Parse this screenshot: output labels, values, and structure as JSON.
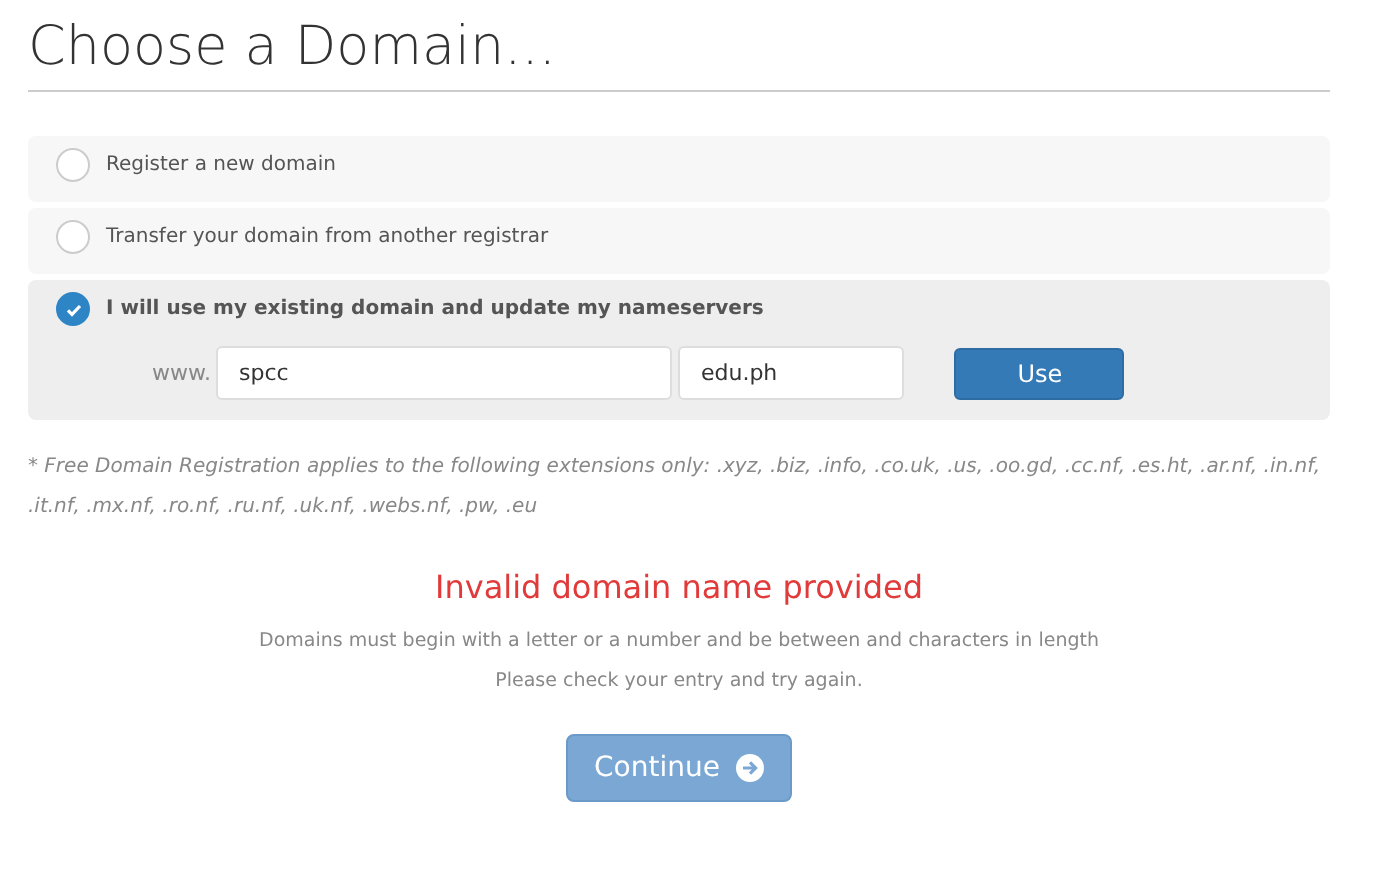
{
  "title": "Choose a Domain...",
  "options": [
    {
      "label": "Register a new domain",
      "selected": false
    },
    {
      "label": "Transfer your domain from another registrar",
      "selected": false
    },
    {
      "label": "I will use my existing domain and update my nameservers",
      "selected": true
    }
  ],
  "domain_form": {
    "prefix": "www.",
    "name": "spcc",
    "extension": "edu.ph",
    "button": "Use"
  },
  "note": "* Free Domain Registration applies to the following extensions only: .xyz, .biz, .info, .co.uk, .us, .oo.gd, .cc.nf, .es.ht, .ar.nf, .in.nf, .it.nf, .mx.nf, .ro.nf, .ru.nf, .uk.nf, .webs.nf, .pw, .eu",
  "error": {
    "title": "Invalid domain name provided",
    "lines": [
      "Domains must begin with a letter or a number and be between and characters in length",
      "Please check your entry and try again."
    ]
  },
  "continue_button": {
    "label": "Continue",
    "disabled": true
  }
}
